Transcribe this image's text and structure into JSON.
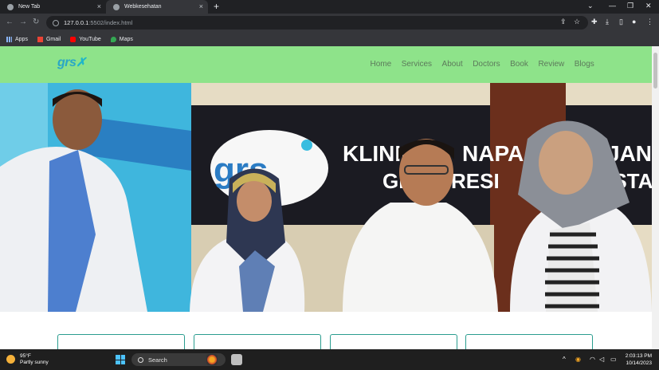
{
  "browser": {
    "tabs": [
      {
        "label": "New Tab"
      },
      {
        "label": "Webkesehatan"
      }
    ],
    "new_tab_glyph": "+",
    "close_glyph": "×",
    "address": {
      "host": "127.0.0.1",
      "path": ":5502/index.html"
    },
    "bookmarks": [
      {
        "label": "Apps",
        "icon": "apps-grid-icon"
      },
      {
        "label": "Gmail",
        "icon": "gmail-icon"
      },
      {
        "label": "YouTube",
        "icon": "youtube-icon"
      },
      {
        "label": "Maps",
        "icon": "maps-icon"
      }
    ]
  },
  "site": {
    "logo": "grs",
    "nav": [
      "Home",
      "Services",
      "About",
      "Doctors",
      "Book",
      "Review",
      "Blogs"
    ],
    "hero_sign": {
      "line1": "KLINIK",
      "line2": "NAPA",
      "line3": "JANT",
      "line4": "GR",
      "line5": "RESI",
      "line6": "ESTA",
      "logo": "grs"
    },
    "colors": {
      "header_bg": "#8ee38a",
      "nav_text": "#5c7a5b",
      "card_border": "#2a9d8f",
      "logo": "#2aa7c5"
    }
  },
  "taskbar": {
    "weather_temp": "95°F",
    "weather_desc": "Partly sunny",
    "search_label": "Search",
    "time": "2:03:13 PM",
    "date": "10/14/2023"
  }
}
